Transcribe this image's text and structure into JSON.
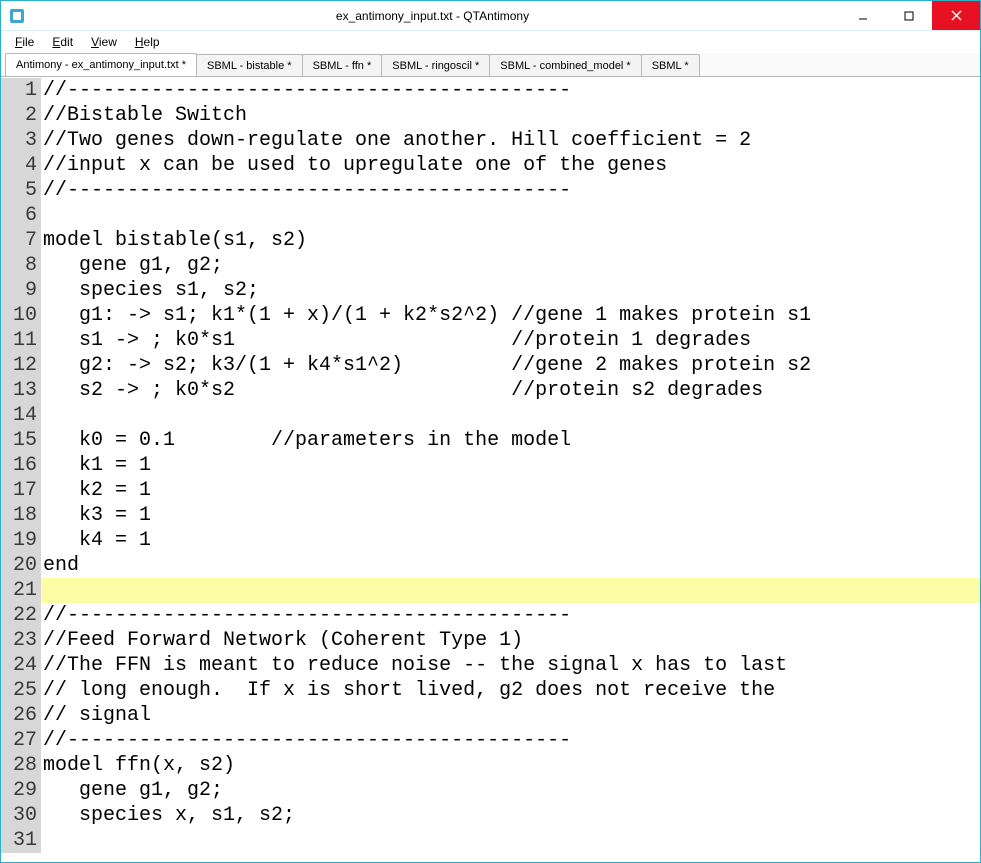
{
  "window": {
    "title": "ex_antimony_input.txt - QTAntimony"
  },
  "menubar": {
    "items": [
      {
        "mnemonic": "F",
        "rest": "ile"
      },
      {
        "mnemonic": "E",
        "rest": "dit"
      },
      {
        "mnemonic": "V",
        "rest": "iew"
      },
      {
        "mnemonic": "H",
        "rest": "elp"
      }
    ]
  },
  "tabs": [
    {
      "label": "Antimony - ex_antimony_input.txt *",
      "active": true
    },
    {
      "label": "SBML - bistable *",
      "active": false
    },
    {
      "label": "SBML - ffn *",
      "active": false
    },
    {
      "label": "SBML - ringoscil *",
      "active": false
    },
    {
      "label": "SBML - combined_model *",
      "active": false
    },
    {
      "label": "SBML *",
      "active": false
    }
  ],
  "editor": {
    "highlight_line": 21,
    "lines": [
      "//------------------------------------------",
      "//Bistable Switch",
      "//Two genes down-regulate one another. Hill coefficient = 2",
      "//input x can be used to upregulate one of the genes",
      "//------------------------------------------",
      "",
      "model bistable(s1, s2)",
      "   gene g1, g2;",
      "   species s1, s2;",
      "   g1: -> s1; k1*(1 + x)/(1 + k2*s2^2) //gene 1 makes protein s1",
      "   s1 -> ; k0*s1                       //protein 1 degrades",
      "   g2: -> s2; k3/(1 + k4*s1^2)         //gene 2 makes protein s2",
      "   s2 -> ; k0*s2                       //protein s2 degrades",
      "",
      "   k0 = 0.1        //parameters in the model",
      "   k1 = 1",
      "   k2 = 1",
      "   k3 = 1",
      "   k4 = 1",
      "end",
      "",
      "//------------------------------------------",
      "//Feed Forward Network (Coherent Type 1)",
      "//The FFN is meant to reduce noise -- the signal x has to last",
      "// long enough.  If x is short lived, g2 does not receive the",
      "// signal",
      "//------------------------------------------",
      "model ffn(x, s2)",
      "   gene g1, g2;",
      "   species x, s1, s2;",
      ""
    ]
  }
}
